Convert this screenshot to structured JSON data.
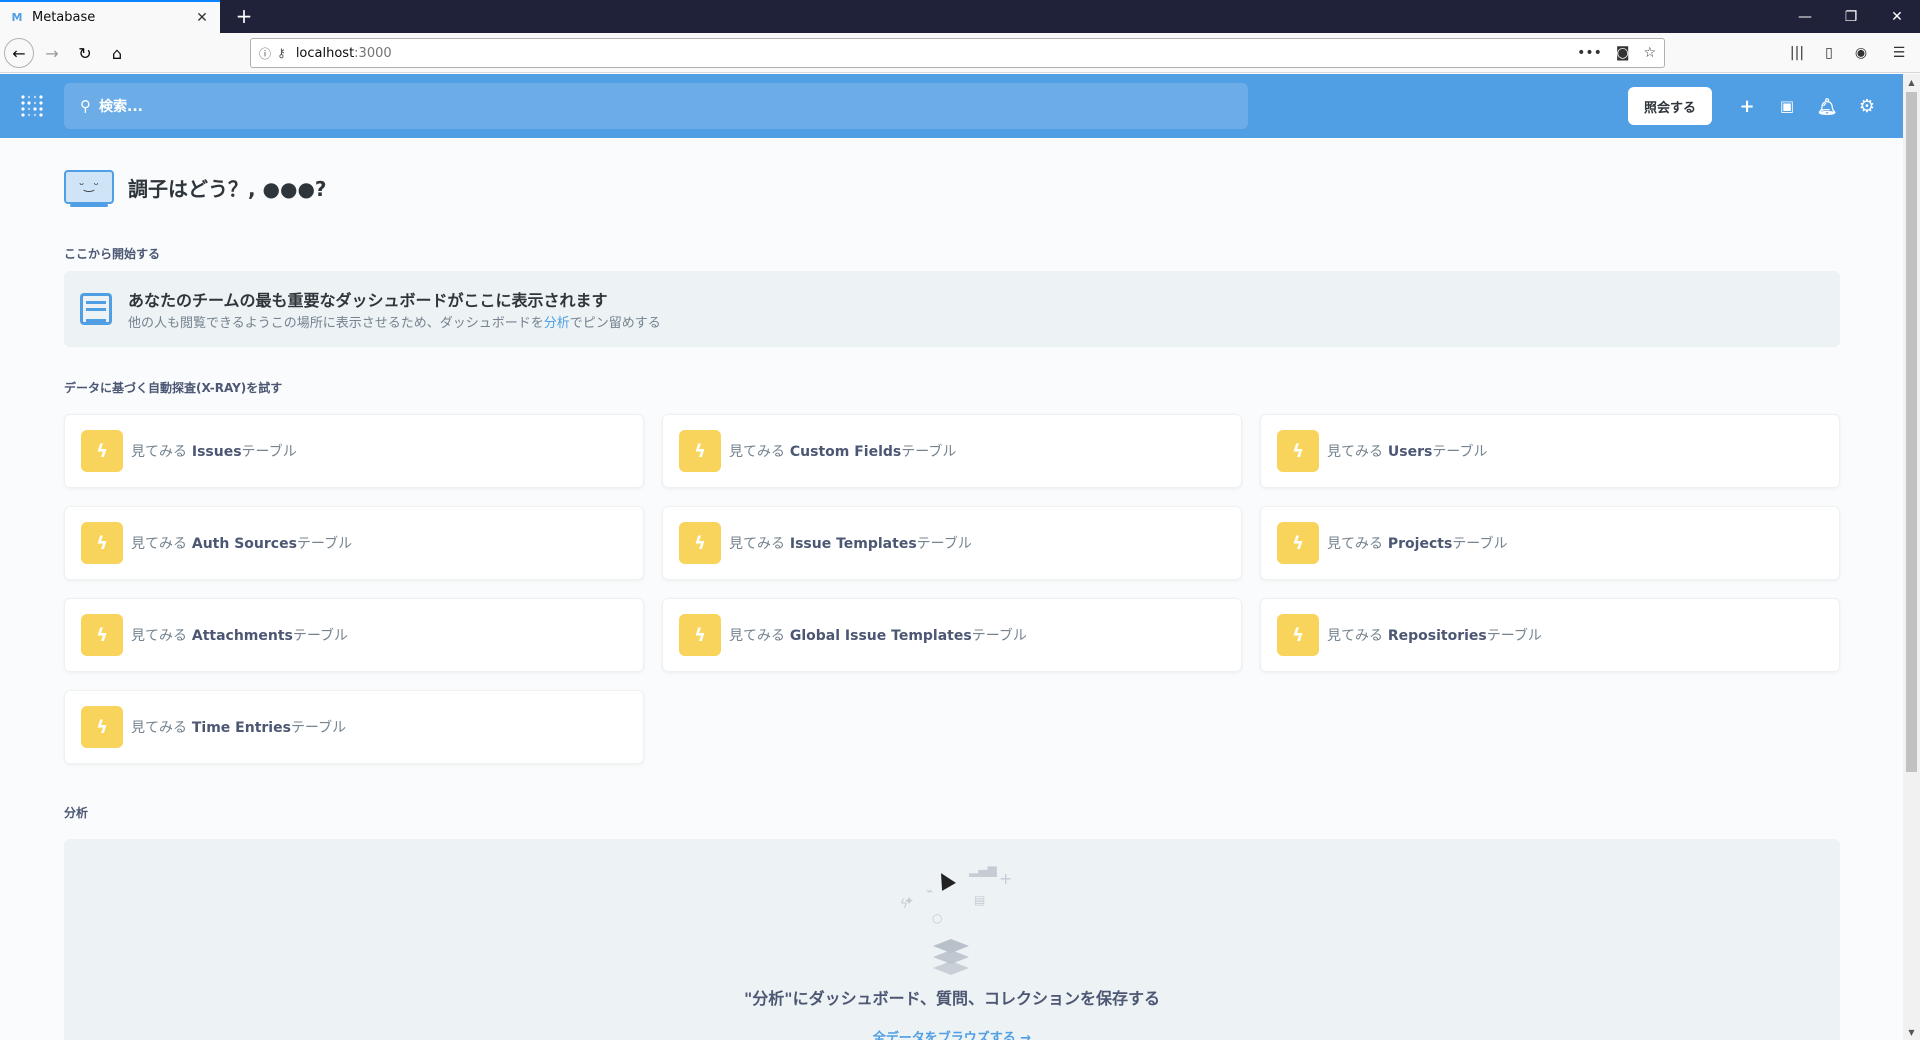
{
  "browser": {
    "tab_title": "Metabase",
    "tab_favicon": "M",
    "url_host": "localhost",
    "url_port": ":3000"
  },
  "header": {
    "search_placeholder": "検索...",
    "ask_button": "照会する",
    "accent": "#509ee3"
  },
  "greeting": {
    "text": "調子はどう？, ●●●?"
  },
  "start_section": {
    "label": "ここから開始する",
    "pin_title": "あなたのチームの最も重要なダッシュボードがここに表示されます",
    "pin_desc_before": "他の人も閲覧できるようこの場所に表示させるため、ダッシュボードを",
    "pin_desc_link": "分析",
    "pin_desc_after": "でピン留めする"
  },
  "xray_section": {
    "label": "データに基づく自動探査(X-RAY)を試す",
    "prefix": "見てみる",
    "items": [
      {
        "name": "Issues",
        "suffix": "テーブル"
      },
      {
        "name": "Custom Fields",
        "suffix": "テーブル"
      },
      {
        "name": "Users",
        "suffix": "テーブル"
      },
      {
        "name": "Auth Sources",
        "suffix": "テーブル"
      },
      {
        "name": "Issue Templates",
        "suffix": "テーブル"
      },
      {
        "name": "Projects",
        "suffix": "テーブル"
      },
      {
        "name": "Attachments",
        "suffix": "テーブル"
      },
      {
        "name": "Global Issue Templates",
        "suffix": "テーブル"
      },
      {
        "name": "Repositories",
        "suffix": "テーブル"
      },
      {
        "name": "Time Entries",
        "suffix": "テーブル"
      }
    ],
    "bolt_color": "#f9d45c"
  },
  "collection_section": {
    "label": "分析",
    "empty_title": "\"分析\"にダッシュボード、質問、コレクションを保存する",
    "browse_link": "全データをブラウズする →"
  }
}
